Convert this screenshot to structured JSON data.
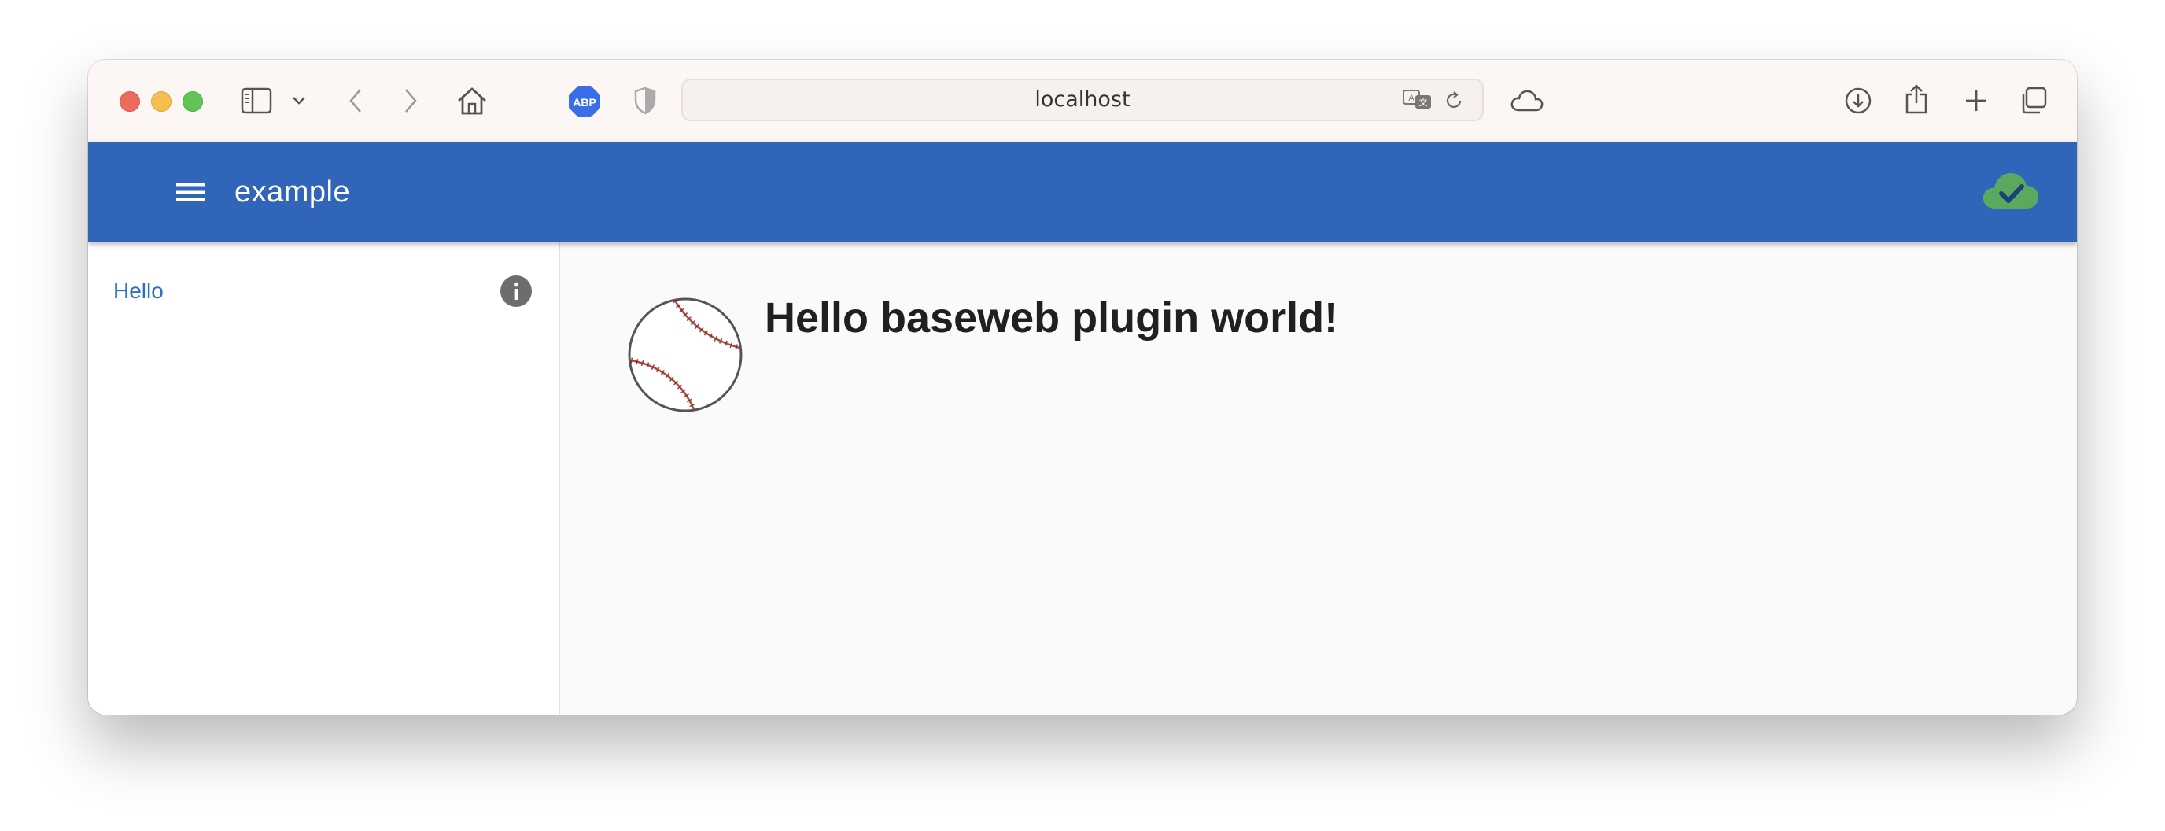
{
  "browser": {
    "url": "localhost",
    "adblock_label": "ABP"
  },
  "app": {
    "title": "example",
    "status_icon": "cloud-check-icon",
    "accent": "#3065ba"
  },
  "sidebar": {
    "items": [
      {
        "label": "Hello",
        "icon": "info-icon"
      }
    ]
  },
  "main": {
    "heading": "Hello baseweb plugin world!",
    "image": "baseball-image"
  }
}
